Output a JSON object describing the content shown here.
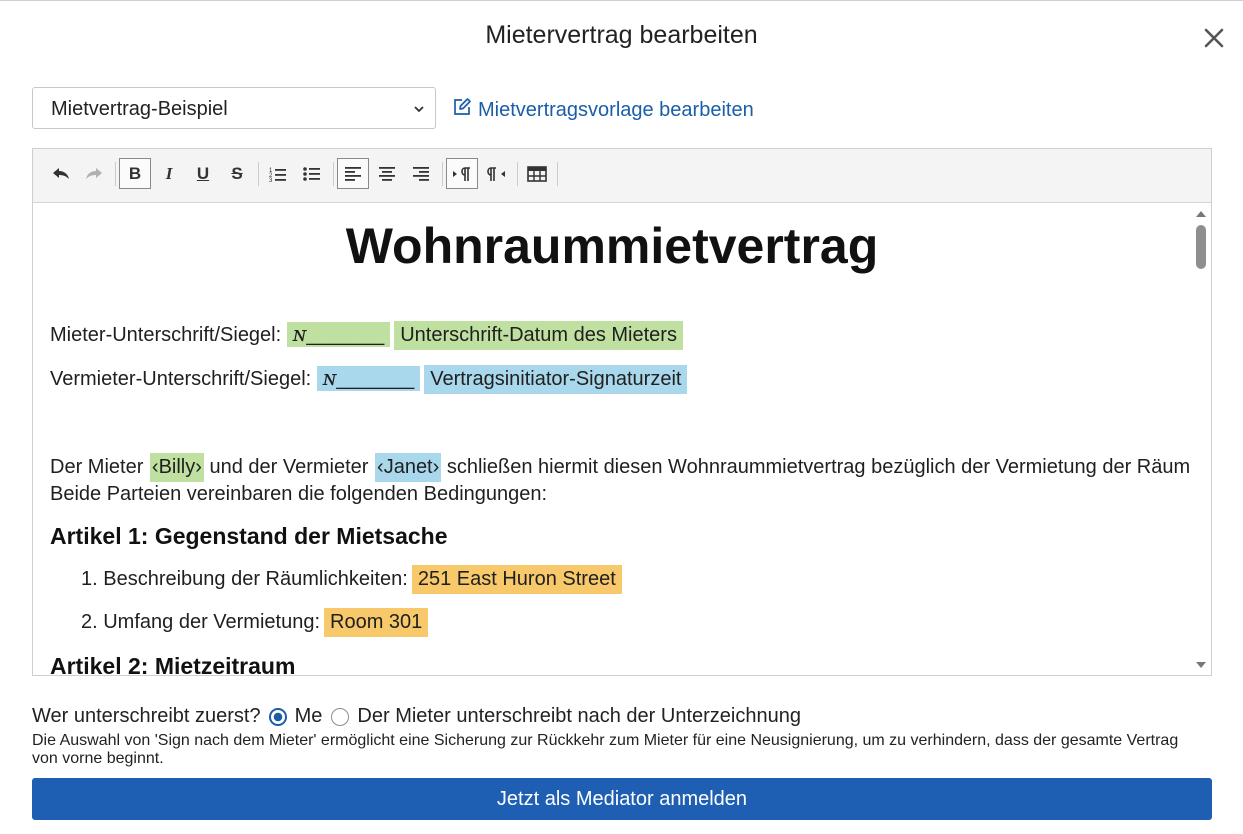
{
  "dialog": {
    "title": "Mietervertrag bearbeiten",
    "close_icon": "close-icon"
  },
  "template_select": {
    "selected": "Mietvertrag-Beispiel"
  },
  "edit_template_link": {
    "label": "Mietvertragsvorlage bearbeiten",
    "icon": "edit-icon"
  },
  "toolbar": {
    "bold": "B",
    "italic": "I",
    "underline": "U",
    "strike": "S",
    "icons": [
      "undo-icon",
      "redo-icon",
      "bold-icon",
      "italic-icon",
      "underline-icon",
      "strikethrough-icon",
      "ordered-list-icon",
      "bullet-list-icon",
      "align-left-icon",
      "align-center-icon",
      "align-right-icon",
      "ltr-icon",
      "rtl-icon",
      "table-icon"
    ]
  },
  "document": {
    "title": "Wohnraummietvertrag",
    "tenant_sig_label": "Mieter-Unterschrift/Siegel:",
    "tenant_sig_mark": "ɴ",
    "tenant_sig_line": "_______",
    "tenant_sig_date": "Unterschrift-Datum des Mieters",
    "landlord_sig_label": "Vermieter-Unterschrift/Siegel:",
    "landlord_sig_mark": "ɴ",
    "landlord_sig_line": "_______",
    "landlord_sig_time": "Vertragsinitiator-Signaturzeit",
    "intro_part1": "Der Mieter",
    "tenant_name": "‹Billy›",
    "intro_part2": "und der Vermieter",
    "landlord_name": "‹Janet›",
    "intro_part3": "schließen hiermit diesen Wohnraummietvertrag bezüglich der Vermietung der Räumlichkeiten.",
    "intro_line2": "Beide Parteien vereinbaren die folgenden Bedingungen:",
    "article1_title": "Artikel 1: Gegenstand der Mietsache",
    "item1_label": "1. Beschreibung der Räumlichkeiten:",
    "item1_value": "251 East Huron Street",
    "item2_label": "2. Umfang der Vermietung:",
    "item2_value": "Room 301",
    "article2_title": "Artikel 2: Mietzeitraum"
  },
  "signing_order": {
    "question": "Wer unterschreibt zuerst?",
    "option_me": "Me",
    "option_tenant": "Der Mieter unterschreibt nach der Unterzeichnung",
    "selected": "Me",
    "hint": "Die Auswahl von 'Sign nach dem Mieter' ermöglicht eine Sicherung zur Rückkehr zum Mieter für eine Neusignierung, um zu verhindern, dass der gesamte Vertrag von vorne beginnt."
  },
  "submit": {
    "label": "Jetzt als Mediator anmelden"
  },
  "colors": {
    "accent": "#1e5fb4",
    "link": "#1a5ea8",
    "hl_green": "#bfe0a0",
    "hl_blue": "#a9d8ec",
    "hl_orange": "#f7c96a"
  }
}
